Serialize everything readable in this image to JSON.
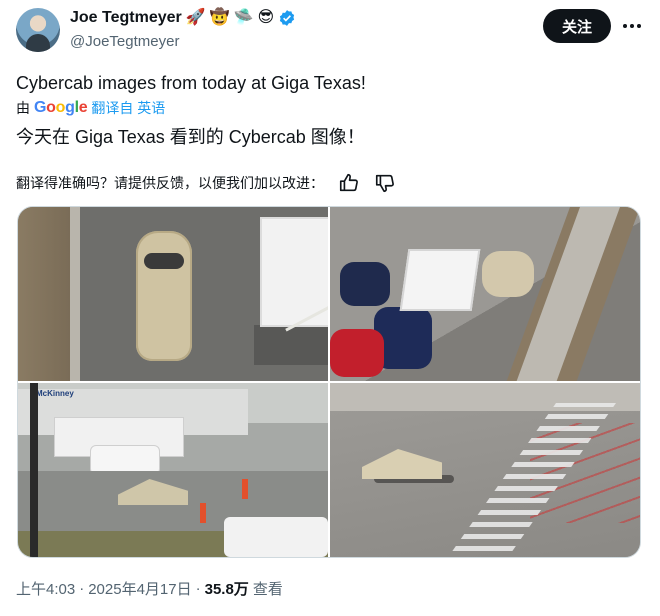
{
  "author": {
    "display_name": "Joe Tegtmeyer",
    "handle": "@JoeTegtmeyer",
    "emojis": [
      "🚀",
      "🤠",
      "🛸",
      "😎"
    ],
    "verified": true,
    "follow_label": "关注"
  },
  "tweet": {
    "text": "Cybercab images from today at Giga Texas!",
    "by_label": "由",
    "google_letters": [
      "G",
      "o",
      "o",
      "g",
      "l",
      "e"
    ],
    "translated_from": "翻译自 英语",
    "translated_text": "今天在 Giga Texas 看到的 Cybercab 图像！",
    "feedback_prompt": "翻译得准确吗？请提供反馈，以便我们加以改进："
  },
  "media": {
    "photo3_sign": "McKinney"
  },
  "meta": {
    "time": "上午4:03",
    "separator": "·",
    "date": "2025年4月17日",
    "views_count": "35.8万",
    "views_label": "查看"
  },
  "colors": {
    "accent": "#1d9bf0",
    "follow_bg": "#0f1419",
    "muted": "#536471"
  },
  "icons": [
    "verified-badge-icon",
    "more-icon",
    "thumbs-up-icon",
    "thumbs-down-icon"
  ]
}
